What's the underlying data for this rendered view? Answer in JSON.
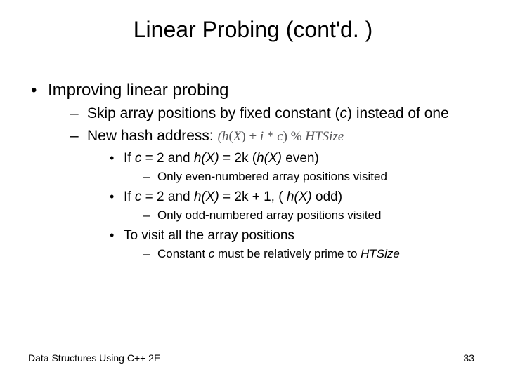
{
  "title": "Linear Probing (cont'd. )",
  "body": {
    "l1_0": "Improving linear probing",
    "l2_0_pre": "Skip array positions by fixed constant (",
    "l2_0_c": "c",
    "l2_0_post": ") instead of one",
    "l2_1": "New hash address: ",
    "formula": "(h(X) + i * c) % HTSize",
    "l3_0_a": "If ",
    "l3_0_b": "c",
    "l3_0_c": " = 2 and ",
    "l3_0_d": "h(X)",
    "l3_0_e": " = 2k (",
    "l3_0_f": "h(X)",
    "l3_0_g": " even)",
    "l4_0": "Only even-numbered array positions visited",
    "l3_1_a": "If ",
    "l3_1_b": "c",
    "l3_1_c": " = 2 and ",
    "l3_1_d": "h(X)",
    "l3_1_e": " = 2k + 1, ( ",
    "l3_1_f": "h(X)",
    "l3_1_g": " odd)",
    "l4_1": "Only odd-numbered array positions visited",
    "l3_2": "To visit all the array positions",
    "l4_2_a": "Constant ",
    "l4_2_b": "c",
    "l4_2_c": " must be relatively prime to ",
    "l4_2_d": "HTSize"
  },
  "footer": {
    "left": "Data Structures Using C++ 2E",
    "right": "33"
  }
}
